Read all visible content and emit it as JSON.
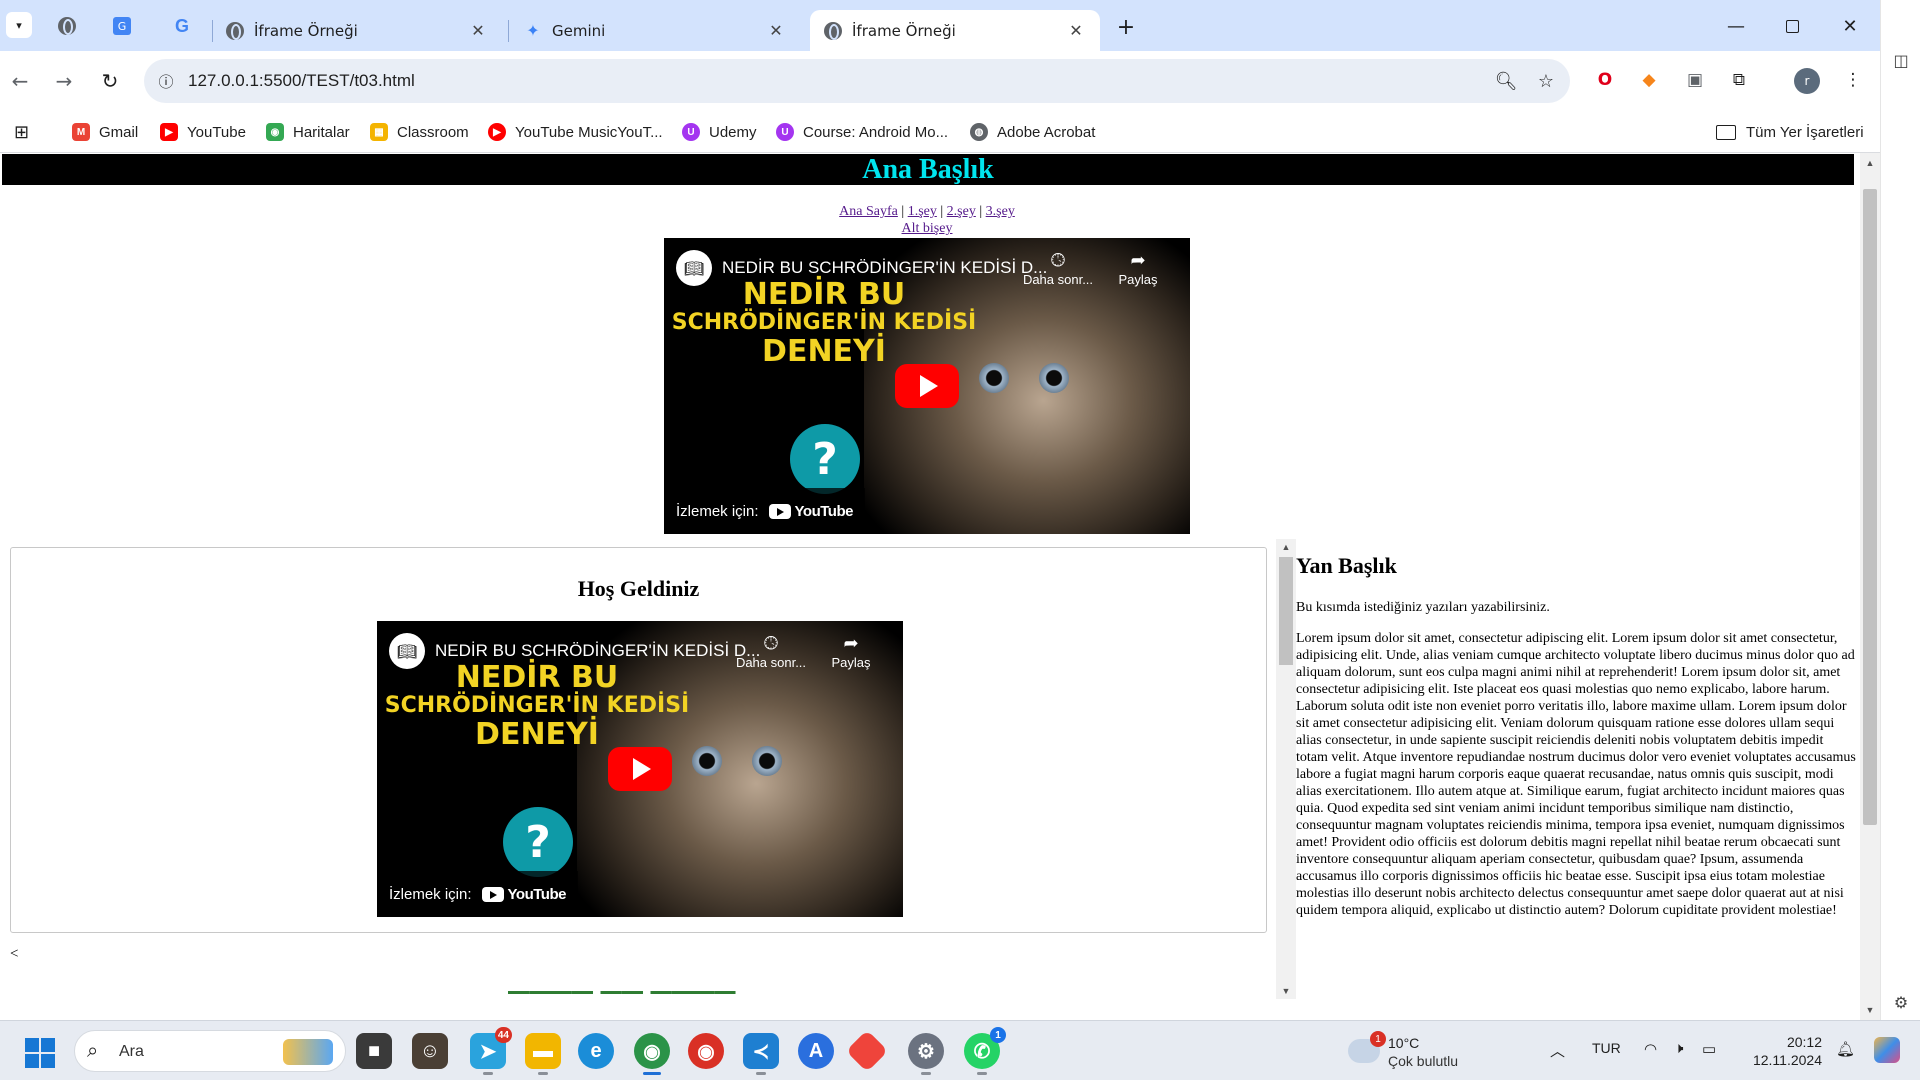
{
  "browser": {
    "tabs": [
      {
        "title": "İframe Örneği",
        "active": false
      },
      {
        "title": "Gemini",
        "active": false
      },
      {
        "title": "İframe Örneği",
        "active": true
      }
    ],
    "tab_close_glyph": "✕",
    "new_tab_glyph": "+",
    "url": "127.0.0.1:5500/TEST/t03.html",
    "bookmarks": [
      {
        "label": "Gmail",
        "icon": "gmail-icon",
        "color": "#ea4335"
      },
      {
        "label": "YouTube",
        "icon": "youtube-icon",
        "color": "#ff0000"
      },
      {
        "label": "Haritalar",
        "icon": "maps-icon",
        "color": "#34a853"
      },
      {
        "label": "Classroom",
        "icon": "classroom-icon",
        "color": "#f4b400"
      },
      {
        "label": "YouTube MusicYouT...",
        "icon": "youtube-music-icon",
        "color": "#ff0000"
      },
      {
        "label": "Udemy",
        "icon": "udemy-icon",
        "color": "#a435f0"
      },
      {
        "label": "Course: Android Mo...",
        "icon": "course-icon",
        "color": "#a435f0"
      },
      {
        "label": "Adobe Acrobat",
        "icon": "globe-icon",
        "color": "#5f6368"
      }
    ],
    "all_bookmarks": "Tüm Yer İşaretleri"
  },
  "page": {
    "header_title": "Ana Başlık",
    "nav": {
      "links": [
        "Ana Sayfa",
        "1.şey",
        "2.şey",
        "3.şey"
      ],
      "separator": "|",
      "sub_link": "Alt bişey"
    },
    "video": {
      "title": "NEDİR BU SCHRÖDİNGER'İN KEDİSİ D...",
      "later": "Daha sonr...",
      "share": "Paylaş",
      "poster_line1": "NEDİR BU",
      "poster_line2": "SCHRÖDİNGER'İN KEDİSİ",
      "poster_line3": "DENEYİ",
      "watch_on": "İzlemek için:",
      "youtube_logo": "YouTube"
    },
    "main_heading": "Hoş Geldiniz",
    "stray_char": "<",
    "aside": {
      "title": "Yan Başlık",
      "lead": "Bu kısımda istediğiniz yazıları yazabilirsiniz.",
      "body": "Lorem ipsum dolor sit amet, consectetur adipiscing elit. Lorem ipsum dolor sit amet consectetur, adipisicing elit. Unde, alias veniam cumque architecto voluptate libero ducimus minus dolor quo ad aliquam dolorum, sunt eos culpa magni animi nihil at reprehenderit! Lorem ipsum dolor sit, amet consectetur adipisicing elit. Iste placeat eos quasi molestias quo nemo explicabo, labore harum. Laborum soluta odit iste non eveniet porro veritatis illo, labore maxime ullam. Lorem ipsum dolor sit amet consectetur adipisicing elit. Veniam dolorum quisquam ratione esse dolores ullam sequi alias consectetur, in unde sapiente suscipit reiciendis deleniti nobis voluptatem debitis impedit totam velit. Atque inventore repudiandae nostrum ducimus dolor vero eveniet voluptates accusamus labore a fugiat magni harum corporis eaque quaerat recusandae, natus omnis quis suscipit, modi alias exercitationem. Illo autem atque at. Similique earum, fugiat architecto incidunt maiores quas quia. Quod expedita sed sint veniam animi incidunt temporibus similique nam distinctio, consequuntur magnam voluptates reiciendis minima, tempora ipsa eveniet, numquam dignissimos amet! Provident odio officiis est dolorum debitis magni repellat nihil beatae rerum obcaecati sunt inventore consequuntur aliquam aperiam consectetur, quibusdam quae? Ipsum, assumenda accusamus illo corporis dignissimos officiis hic beatae esse. Suscipit ipsa eius totam molestiae molestias illo deserunt nobis architecto delectus consequuntur amet saepe dolor quaerat aut at nisi quidem tempora aliquid, explicabo ut distinctio autem? Dolorum cupiditate provident molestiae!"
    }
  },
  "taskbar": {
    "search_placeholder": "Ara",
    "apps": [
      {
        "name": "file-explorer-icon",
        "badge": ""
      },
      {
        "name": "telegram-icon",
        "badge": "44"
      },
      {
        "name": "folder-icon",
        "badge": ""
      },
      {
        "name": "edge-icon",
        "badge": ""
      },
      {
        "name": "chrome-icon",
        "badge": ""
      },
      {
        "name": "chrome-profile-icon",
        "badge": ""
      },
      {
        "name": "vscode-icon",
        "badge": ""
      },
      {
        "name": "translate-icon",
        "badge": ""
      },
      {
        "name": "anydesk-icon",
        "badge": ""
      },
      {
        "name": "settings-icon",
        "badge": ""
      },
      {
        "name": "whatsapp-icon",
        "badge": "1"
      }
    ],
    "weather_badge": "1",
    "weather_temp": "10°C",
    "weather_desc": "Çok bulutlu",
    "language": "TUR",
    "time": "20:12",
    "date": "12.11.2024"
  },
  "colors": {
    "header_bg": "#000000",
    "header_text": "#00e5ee",
    "link": "#551a8b",
    "youtube_red": "#ff0000",
    "tabstrip": "#d3e3fd"
  }
}
